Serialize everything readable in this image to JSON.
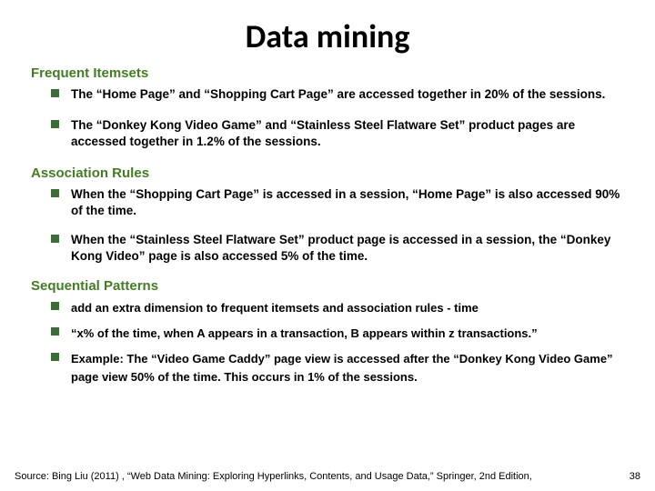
{
  "title": "Data mining",
  "sections": [
    {
      "heading": "Frequent Itemsets",
      "items": [
        "The “Home Page” and “Shopping Cart Page” are accessed together in 20% of the sessions.",
        "The “Donkey Kong Video Game” and “Stainless Steel Flatware Set” product pages are accessed together in 1.2% of the sessions."
      ]
    },
    {
      "heading": "Association Rules",
      "items": [
        "When the “Shopping Cart Page” is accessed in a session, “Home Page” is also accessed 90% of the time.",
        "When the “Stainless Steel Flatware Set” product page is accessed in a session, the “Donkey Kong Video” page is also accessed 5% of the time."
      ]
    },
    {
      "heading": "Sequential Patterns",
      "items": [
        "add an extra dimension to frequent itemsets and association rules - time",
        "“x% of the time, when A appears in a transaction, B appears within z transactions.”",
        "Example: The “Video Game Caddy” page view is accessed after the “Donkey Kong Video Game” page view 50% of the time. This occurs in 1% of the sessions."
      ]
    }
  ],
  "footer_source": "Source: Bing Liu (2011) , “Web Data Mining: Exploring Hyperlinks, Contents, and Usage Data,” Springer, 2nd Edition,",
  "page_number": "38"
}
